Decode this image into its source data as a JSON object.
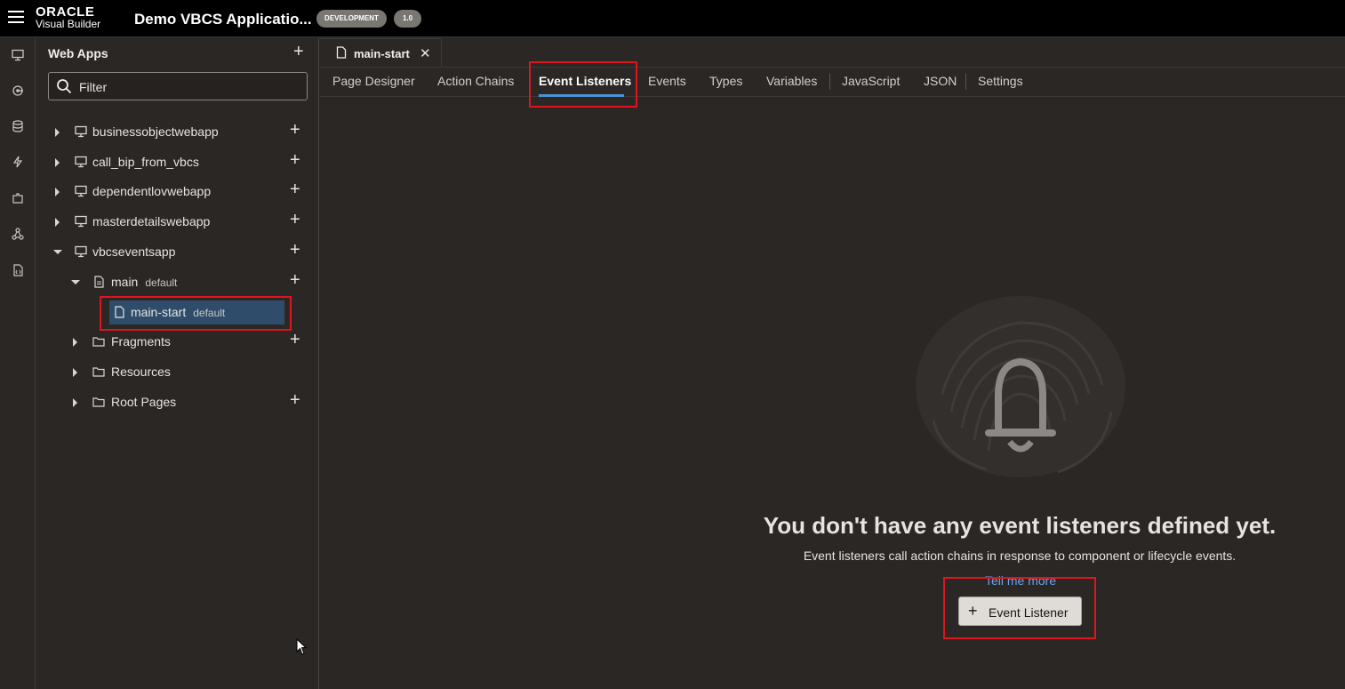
{
  "header": {
    "logo_line1": "ORACLE",
    "logo_line2": "Visual Builder",
    "app_title": "Demo VBCS Applicatio...",
    "env_badge": "DEVELOPMENT",
    "version_badge": "1.0"
  },
  "icon_rail": [
    "web-apps-icon",
    "services-icon",
    "business-objects-icon",
    "processes-icon",
    "components-icon",
    "layouts-icon",
    "source-icon"
  ],
  "sidebar": {
    "title": "Web Apps",
    "filter_placeholder": "Filter",
    "tree": [
      {
        "label": "businessobjectwebapp",
        "tag": ""
      },
      {
        "label": "call_bip_from_vbcs",
        "tag": ""
      },
      {
        "label": "dependentlovwebapp",
        "tag": ""
      },
      {
        "label": "masterdetailswebapp",
        "tag": ""
      },
      {
        "label": "vbcseventsapp",
        "tag": ""
      },
      {
        "label": "main",
        "tag": "default"
      },
      {
        "label": "main-start",
        "tag": "default"
      },
      {
        "label": "Fragments",
        "tag": ""
      },
      {
        "label": "Resources",
        "tag": ""
      },
      {
        "label": "Root Pages",
        "tag": ""
      }
    ]
  },
  "editor": {
    "file_tab": "main-start",
    "tabs": [
      "Page Designer",
      "Action Chains",
      "Event Listeners",
      "Events",
      "Types",
      "Variables",
      "JavaScript",
      "JSON",
      "Settings"
    ],
    "active_tab": "Event Listeners"
  },
  "empty_state": {
    "title": "You don't have any event listeners defined yet.",
    "description": "Event listeners call action chains in response to component or lifecycle events.",
    "link": "Tell me more",
    "button": "Event Listener"
  },
  "colors": {
    "background": "#2b2725",
    "topbar": "#000000",
    "selection": "#2f4d6b",
    "active_tab_underline": "#4f8fd6",
    "link": "#6aa4e8",
    "highlight_box": "#e0141e"
  }
}
